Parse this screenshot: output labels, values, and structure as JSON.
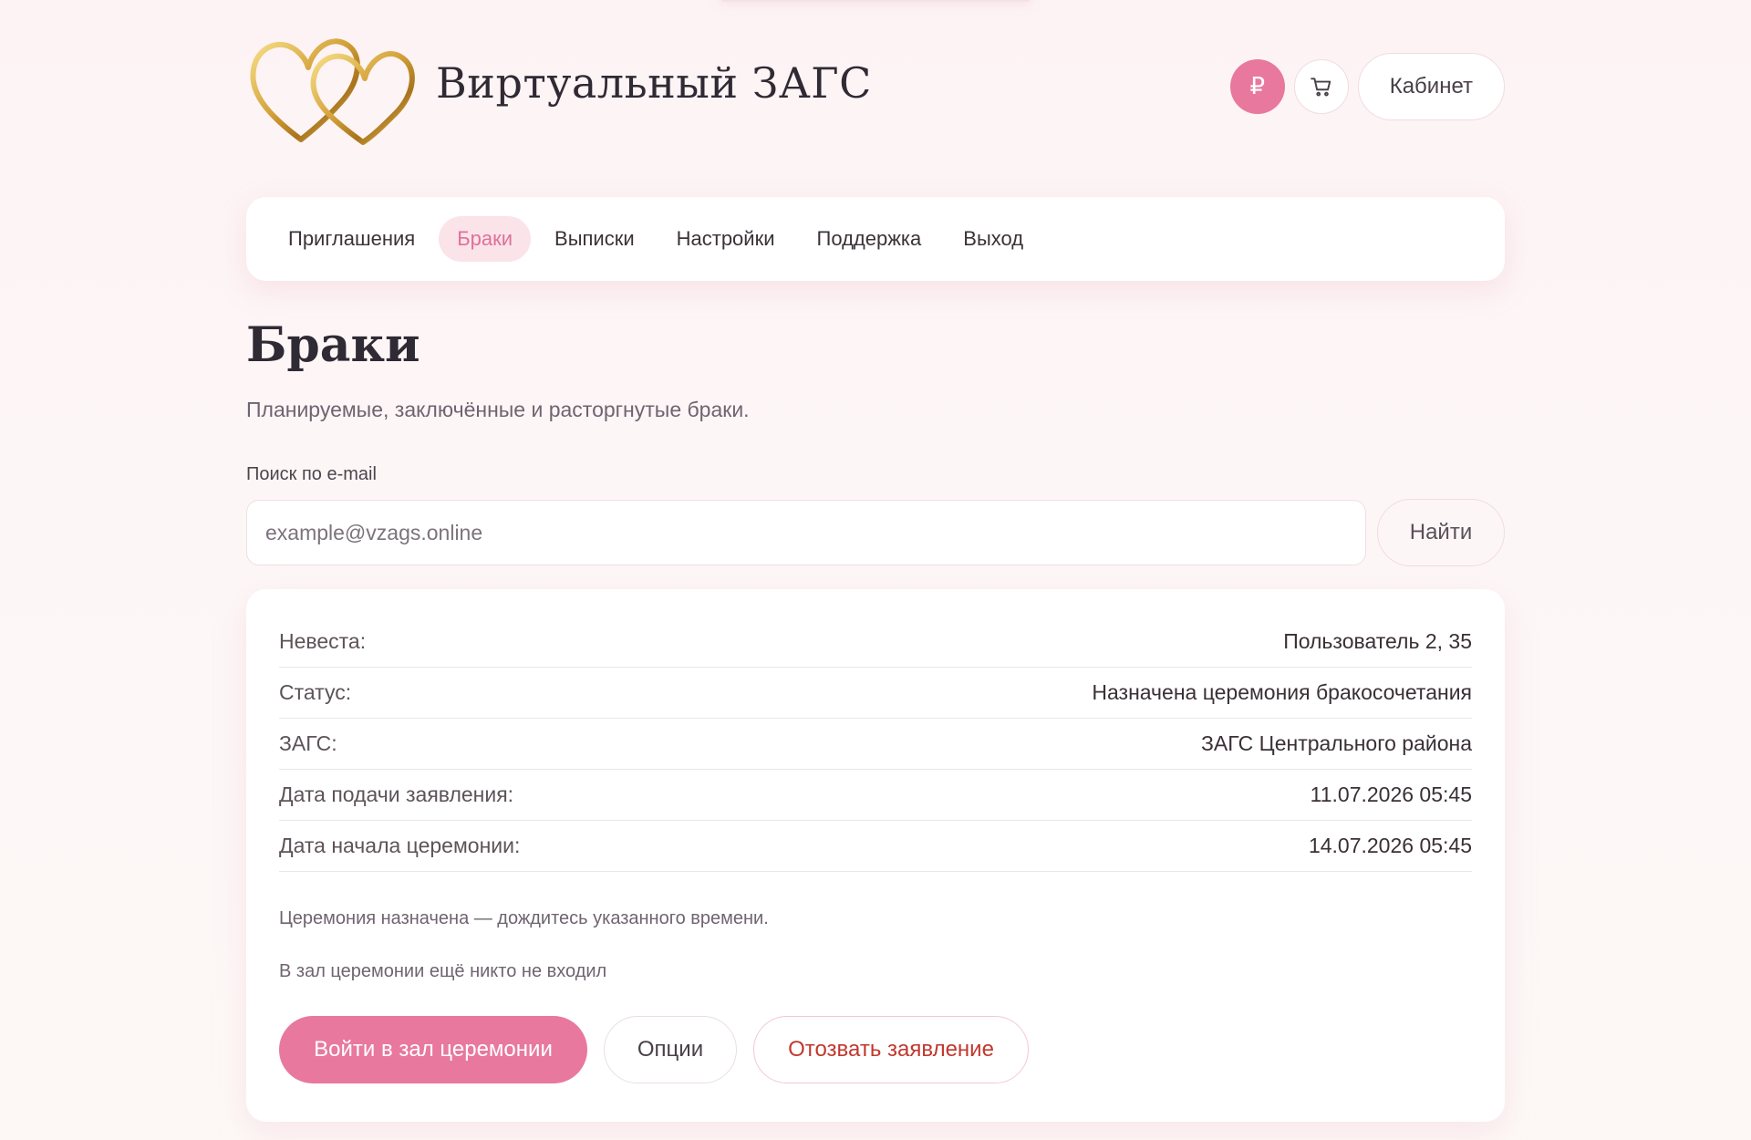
{
  "header": {
    "brand": "Виртуальный ЗАГС",
    "ruble_symbol": "₽",
    "cabinet_label": "Кабинет"
  },
  "nav": {
    "items": [
      {
        "label": "Приглашения",
        "active": false
      },
      {
        "label": "Браки",
        "active": true
      },
      {
        "label": "Выписки",
        "active": false
      },
      {
        "label": "Настройки",
        "active": false
      },
      {
        "label": "Поддержка",
        "active": false
      },
      {
        "label": "Выход",
        "active": false
      }
    ]
  },
  "page": {
    "title": "Браки",
    "subtitle": "Планируемые, заключённые и расторгнутые браки."
  },
  "search": {
    "label": "Поиск по e-mail",
    "placeholder": "example@vzags.online",
    "value": "",
    "button": "Найти"
  },
  "marriage": {
    "rows": [
      {
        "label": "Невеста:",
        "value": "Пользователь 2, 35"
      },
      {
        "label": "Статус:",
        "value": "Назначена церемония бракосочетания"
      },
      {
        "label": "ЗАГС:",
        "value": "ЗАГС Центрального района"
      },
      {
        "label": "Дата подачи заявления:",
        "value": "11.07.2026 05:45"
      },
      {
        "label": "Дата начала церемонии:",
        "value": "14.07.2026 05:45"
      }
    ],
    "note1": "Церемония назначена — дождитесь указанного времени.",
    "note2": "В зал церемонии ещё никто не входил",
    "enter_button": "Войти в зал церемонии",
    "options_button": "Опции",
    "revoke_button": "Отозвать заявление"
  },
  "colors": {
    "accent": "#e8789e",
    "accent_light": "#fbe3ea",
    "danger": "#c0382e",
    "background": "#fdf3f5"
  }
}
